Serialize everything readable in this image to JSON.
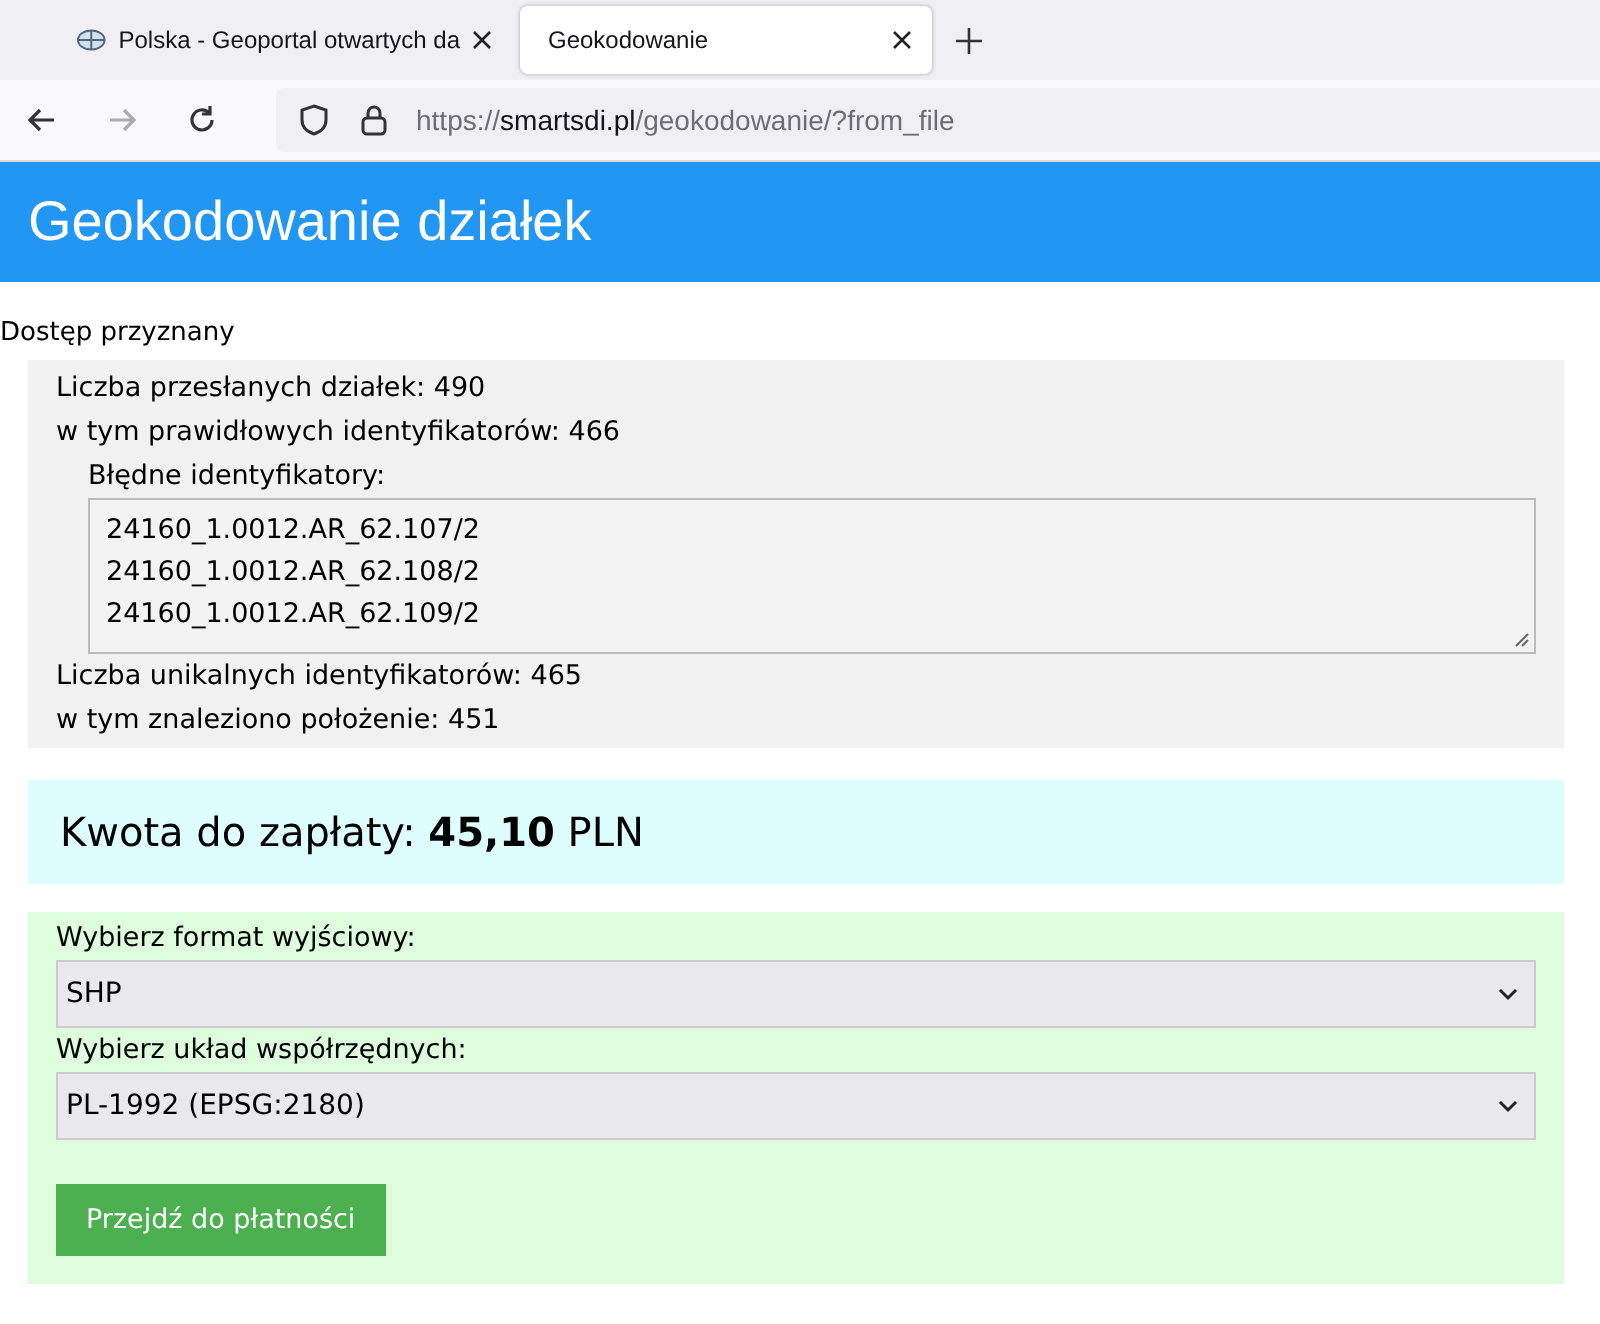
{
  "browser": {
    "tabs": [
      {
        "title": "Polska - Geoportal otwartych da",
        "selected": false
      },
      {
        "title": "Geokodowanie",
        "selected": true
      }
    ],
    "url": {
      "scheme": "https://",
      "host": "smartsdi.pl",
      "path": "/geokodowanie/?from_file"
    }
  },
  "header": {
    "title": "Geokodowanie działek"
  },
  "status": "Dostęp przyznany",
  "summary": {
    "lines_top": [
      "Liczba przesłanych działek: 490",
      "w tym prawidłowych identyfikatorów: 466"
    ],
    "invalid_label": "Błędne identyfikatory:",
    "invalid_ids": [
      "24160_1.0012.AR_62.107/2",
      "24160_1.0012.AR_62.108/2",
      "24160_1.0012.AR_62.109/2"
    ],
    "lines_bottom": [
      "Liczba unikalnych identyfikatorów: 465",
      "w tym znaleziono położenie: 451"
    ]
  },
  "payment": {
    "amount_text": "Kwota do zapłaty: **45,10** PLN"
  },
  "form": {
    "fields": [
      {
        "label": "Wybierz format wyjściowy:",
        "value": "SHP"
      },
      {
        "label": "Wybierz układ współrzędnych:",
        "value": "PL-1992 (EPSG:2180)"
      }
    ],
    "submit": "Przejdź do płatności"
  }
}
